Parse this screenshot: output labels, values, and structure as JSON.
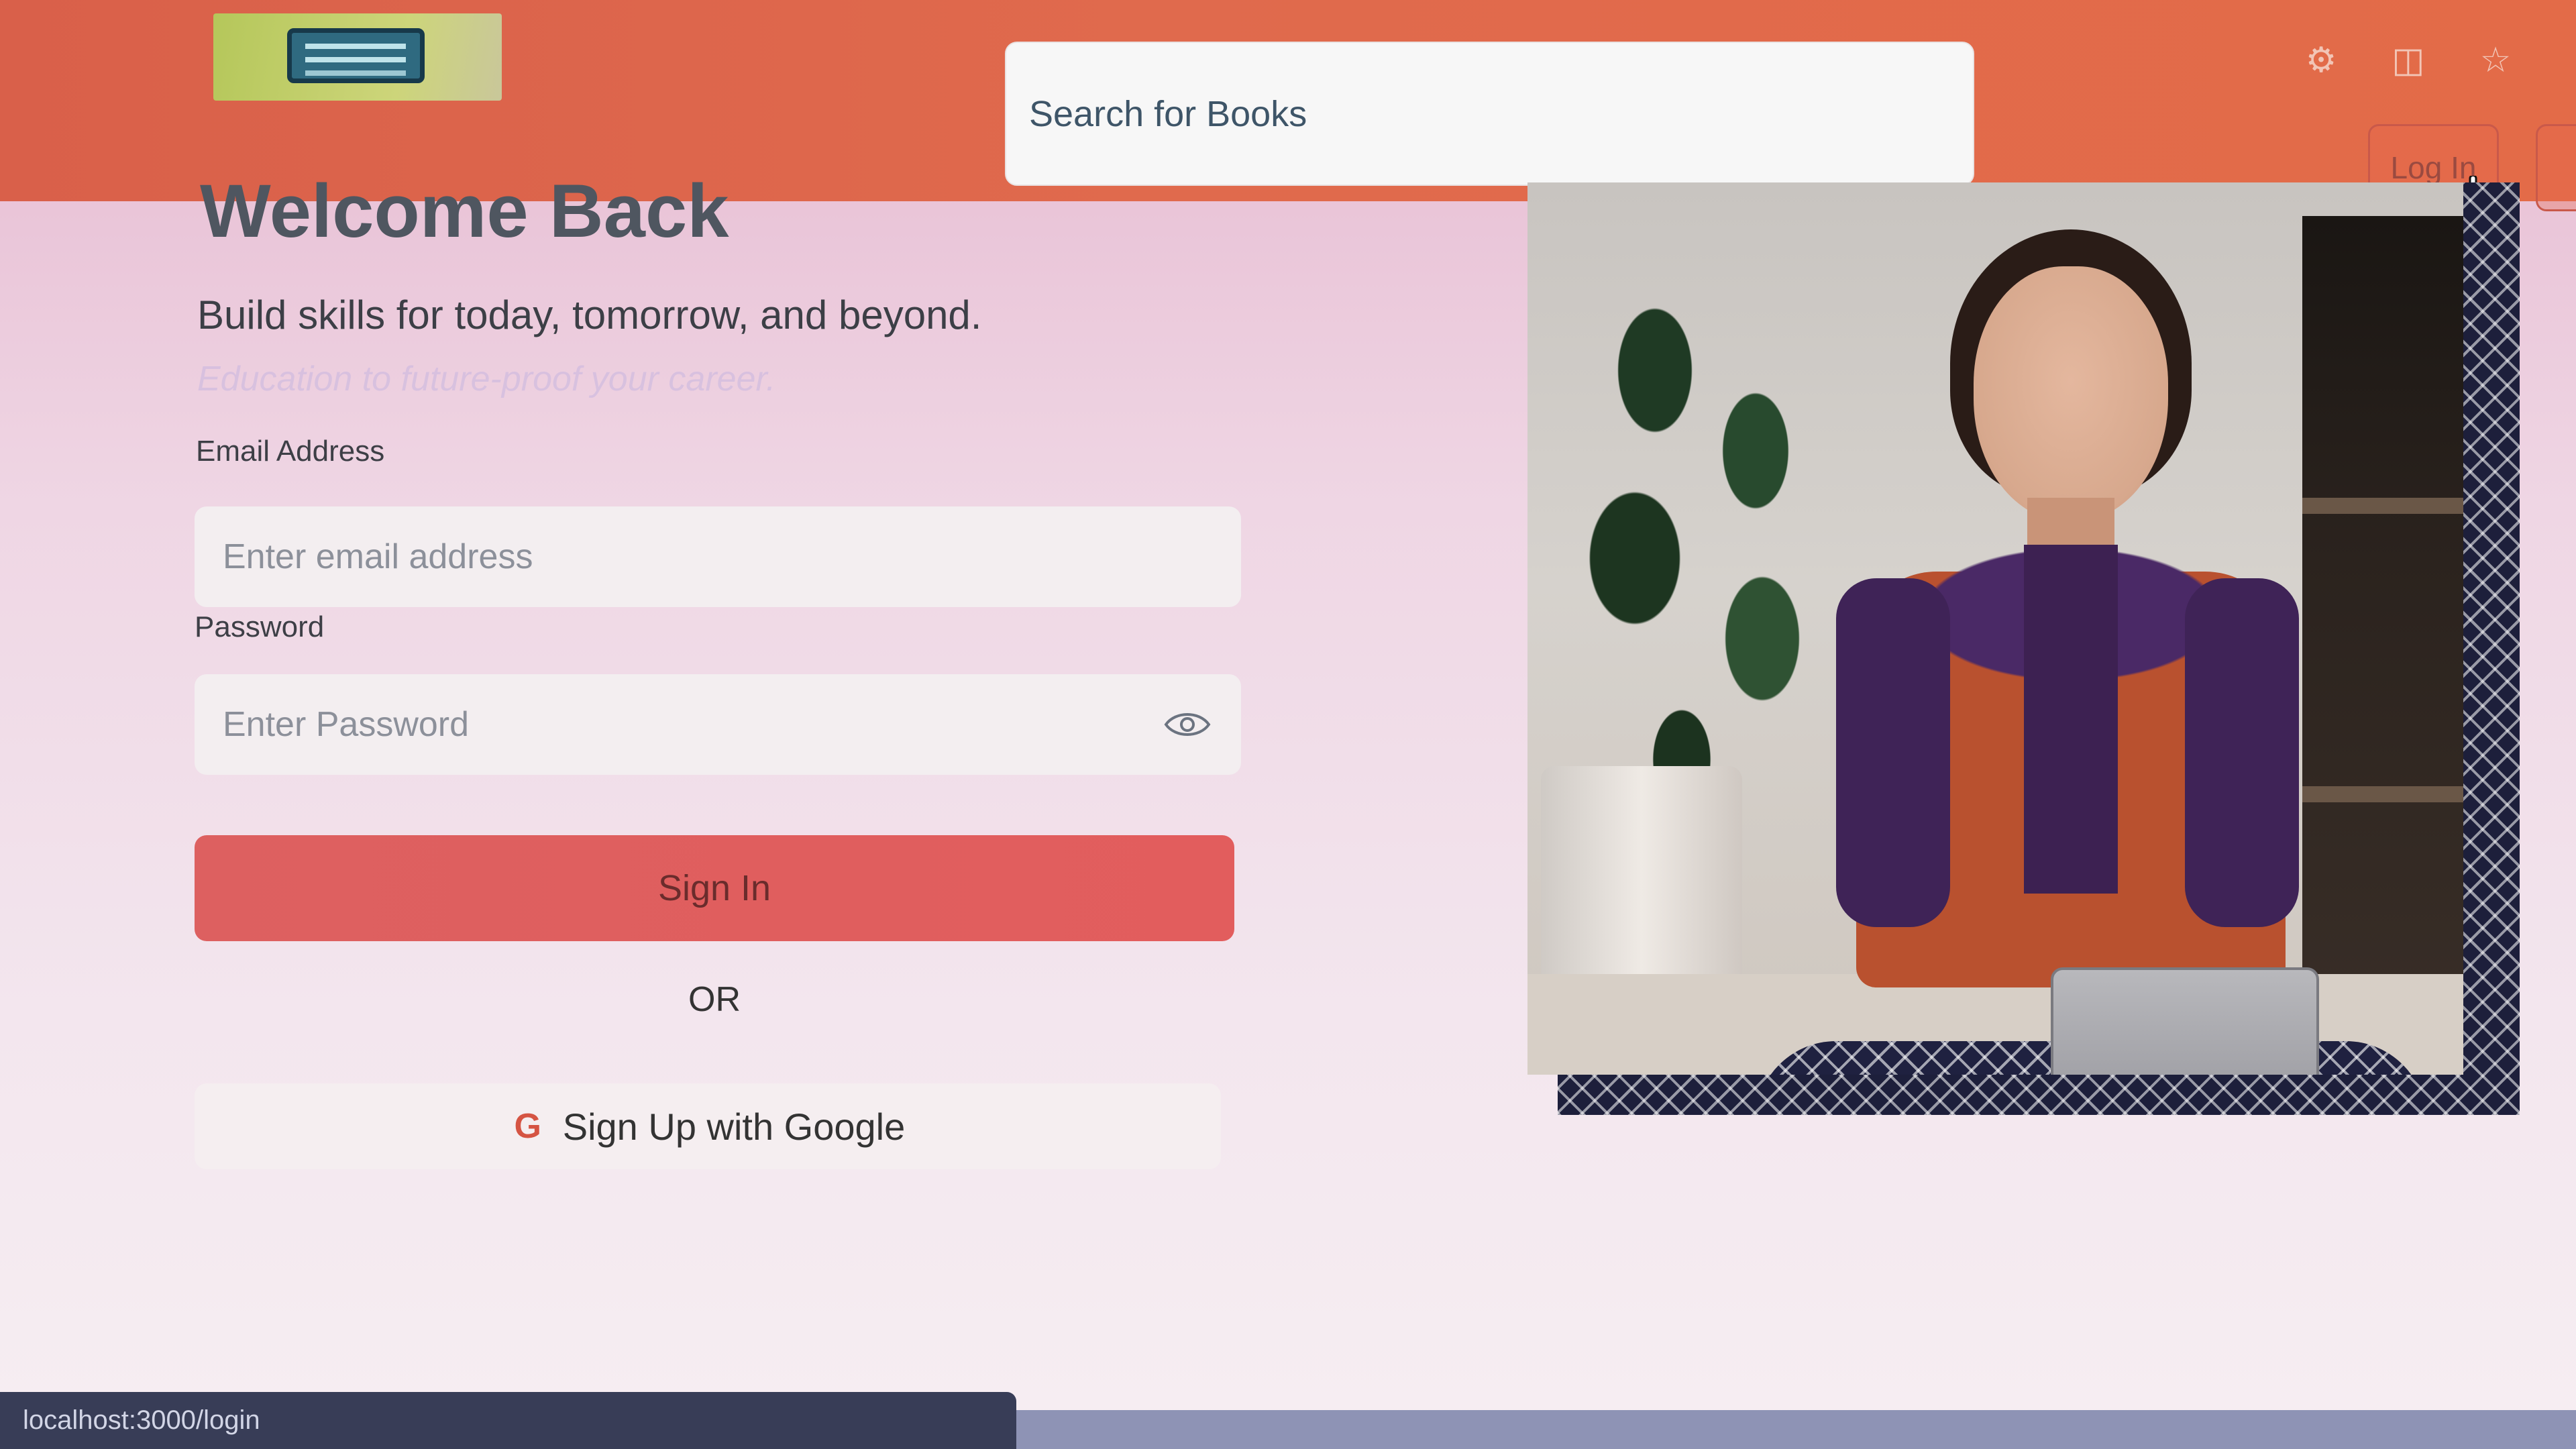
{
  "header": {
    "search": {
      "placeholder": "Search for Books"
    },
    "login_label": "Log In",
    "browser_icons": [
      "extensions-icon",
      "split-view-icon",
      "favorites-icon"
    ]
  },
  "form": {
    "title": "Welcome Back",
    "tagline": "Build skills for today, tomorrow, and beyond.",
    "subtagline": "Education to future-proof your career.",
    "email": {
      "label": "Email Address",
      "placeholder": "Enter email address"
    },
    "password": {
      "label": "Password",
      "placeholder": "Enter Password"
    },
    "sign_in_label": "Sign In",
    "or_label": "OR",
    "google_label": "Sign Up with Google"
  },
  "statusbar": {
    "url": "localhost:3000/login"
  },
  "colors": {
    "header": "#e06a4d",
    "signin": "#e25d5d",
    "page": "#efd6e4"
  }
}
